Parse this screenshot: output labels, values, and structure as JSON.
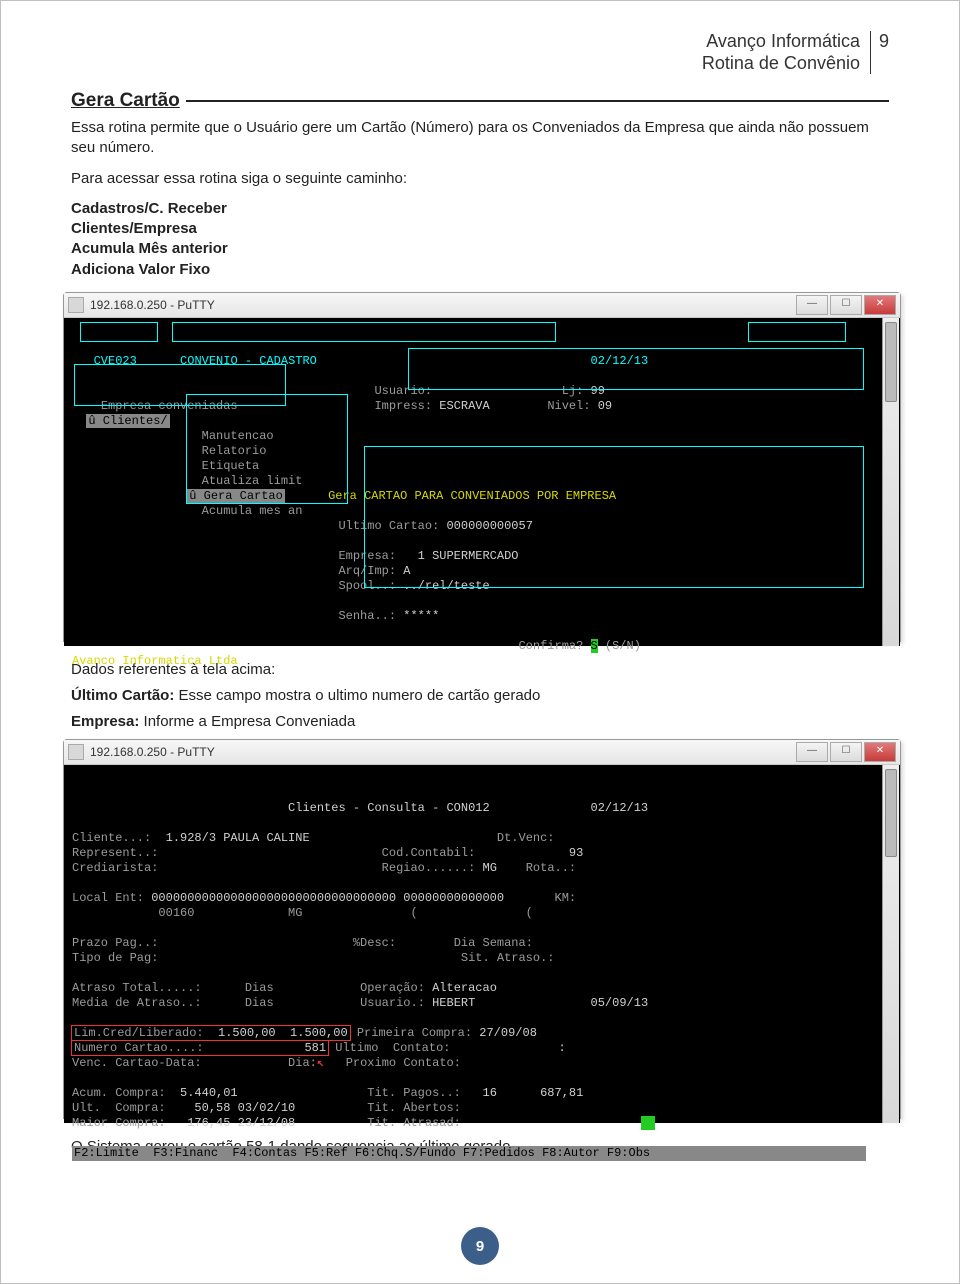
{
  "header": {
    "brand_line1": "Avanço Informática",
    "brand_line2": "Rotina de Convênio",
    "page_num": "9"
  },
  "title": "Gera Cartão",
  "intro": "Essa rotina permite que o Usuário gere um Cartão (Número) para os Conveniados da Empresa que ainda não possuem seu número.",
  "access": "Para acessar essa rotina siga o seguinte caminho:",
  "nav": {
    "l1": "Cadastros/C. Receber",
    "l2": "Clientes/Empresa",
    "l3": "Acumula Mês anterior",
    "l4": "Adiciona Valor Fixo"
  },
  "putty1": {
    "title": "192.168.0.250 - PuTTY",
    "top": {
      "code": "CVE023",
      "name": "CONVENIO - CADASTRO",
      "date": "02/12/13"
    },
    "status": {
      "usuario_k": "Usuario:",
      "lj_k": "Lj:",
      "lj_v": "99",
      "impress_k": "Impress:",
      "impress_v": "ESCRAVA",
      "nivel_k": "Nivel:",
      "nivel_v": "09"
    },
    "leftmenu": {
      "head": "Empresa conveniadas",
      "sub": "û Clientes/"
    },
    "midmenu": [
      "Manutencao",
      "Relatorio",
      "Etiqueta",
      "Atualiza limit",
      "û Gera Cartao",
      "Acumula mes an"
    ],
    "box": {
      "title": "Gera CARTAO PARA CONVENIADOS POR EMPRESA",
      "ultimo_k": "Ultimo Cartao:",
      "ultimo_v": "000000000057",
      "empresa_k": "Empresa:",
      "empresa_v": "  1 SUPERMERCADO",
      "arqimp_k": "Arq/Imp:",
      "arqimp_v": "A",
      "spool_k": "Spool..:",
      "spool_v": "../rel/teste",
      "senha_k": "Senha..:",
      "senha_v": "*****",
      "confirm_k": "Confirma?",
      "confirm_v": "S",
      "confirm_sn": "(S/N)"
    },
    "footer": "Avanco Informatica Ltda"
  },
  "mid": {
    "dados": "Dados referentes à tela acima:",
    "ultimo_lbl": "Último Cartão:",
    "ultimo_txt": " Esse campo mostra o ultimo numero de cartão gerado",
    "empresa_lbl": "Empresa:",
    "empresa_txt": " Informe a Empresa Conveniada"
  },
  "putty2": {
    "title": "192.168.0.250 - PuTTY",
    "top": {
      "name": "Clientes - Consulta - CON012",
      "date": "02/12/13"
    },
    "cliente_k": "Cliente...:",
    "cliente_v": "  1.928/3 PAULA CALINE",
    "dtvenc": "Dt.Venc:",
    "represent": "Represent..:",
    "codcont_k": "Cod.Contabil:",
    "codcont_v": "93",
    "crediarista": "Crediarista:",
    "regiao_k": "Regiao......:",
    "regiao_v": "MG",
    "rota": "Rota..:",
    "local": "Local Ent:",
    "localv": "0000000000000000000000000000000000 00000000000000",
    "km": "KM:",
    "local2": "            00160             MG               (               (",
    "prazo": "Prazo Pag..:",
    "desc": "%Desc:",
    "dia": "Dia Semana:",
    "tipo": "Tipo de Pag:",
    "sit": "Sit. Atraso.:",
    "atraso_t": "Atraso Total.....:",
    "dias": "Dias",
    "opera_k": "Operação:",
    "opera_v": "Alteracao",
    "media": "Media de Atraso..:",
    "usu_k": "Usuario.:",
    "usu_v": "HEBERT",
    "usu_d": "05/09/13",
    "lim_k": "Lim.Cred/Liberado:",
    "lim_v": "  1.500,00  1.500,00",
    "prim_k": "Primeira Compra:",
    "prim_v": "27/09/08",
    "num_k": "Numero Cartao....:",
    "num_v": "581",
    "ultc_k": "Ultimo  Contato:",
    "ultc_v": ":",
    "venc_k": "Venc. Cartao-Data:",
    "dia_k": "Dia:",
    "prox_k": "Proximo Contato:",
    "acum_k": "Acum. Compra:",
    "acum_v": "  5.440,01",
    "tpag_k": "Tit. Pagos..:",
    "tpag_v": "16      687,81",
    "ultcompra_k": "Ult.  Compra:",
    "ultcompra_v": "    50,58 03/02/10",
    "tabe_k": "Tit. Abertos:",
    "maior_k": "Maior Compra:",
    "maior_v": "   176,45 23/12/08",
    "tatr_k": "Tit. Atrasad:",
    "fkeys": "F2:Limite  F3:Financ  F4:Contas F5:Ref F6:Chq.S/Fundo F7:Pedidos F8:Autor F9:Obs"
  },
  "closing": "O Sistema gerou o cartão 58-1 dando sequencia ao último gerado.",
  "footer": "9"
}
